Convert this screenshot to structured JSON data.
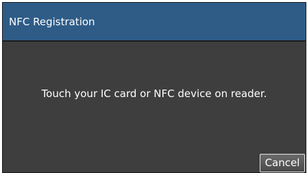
{
  "dialog": {
    "title": "NFC Registration",
    "message": "Touch your IC card or NFC device on reader.",
    "cancel_label": "Cancel"
  }
}
